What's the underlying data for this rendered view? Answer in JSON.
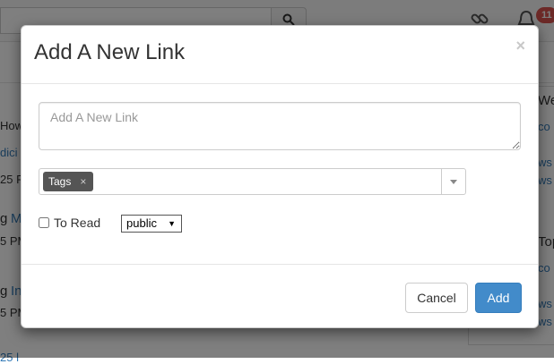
{
  "background": {
    "badge_count": "11",
    "fragments": {
      "how": "How",
      "dici": "dici",
      "t25a": "25 F",
      "gM_g": "g",
      "gM_M": "M",
      "pm1": "5 PM",
      "gI_g": "g",
      "gI_I": "In",
      "pm2": "5 PM",
      "bottom": "25 l",
      "we": "We",
      "co1": "co",
      "ws1": "ws",
      "ws2": "ws",
      "top": "Top",
      "co2": "co",
      "ws3": "ws",
      "ws4": "ws"
    }
  },
  "modal": {
    "title": "Add A New Link",
    "close_label": "×",
    "link_input": {
      "value": "",
      "placeholder": "Add A New Link"
    },
    "tags": [
      {
        "label": "Tags",
        "remove": "×"
      }
    ],
    "to_read_label": "To Read",
    "to_read_checked": false,
    "visibility": {
      "selected": "public"
    },
    "cancel_label": "Cancel",
    "add_label": "Add"
  },
  "colors": {
    "primary": "#428bca",
    "badge": "#d9534f",
    "tag_chip": "#555555",
    "link": "#337ab7"
  },
  "icons": {
    "search": "search-icon",
    "links": "links-icon",
    "bell": "bell-icon",
    "dropdown": "caret-down-icon"
  }
}
